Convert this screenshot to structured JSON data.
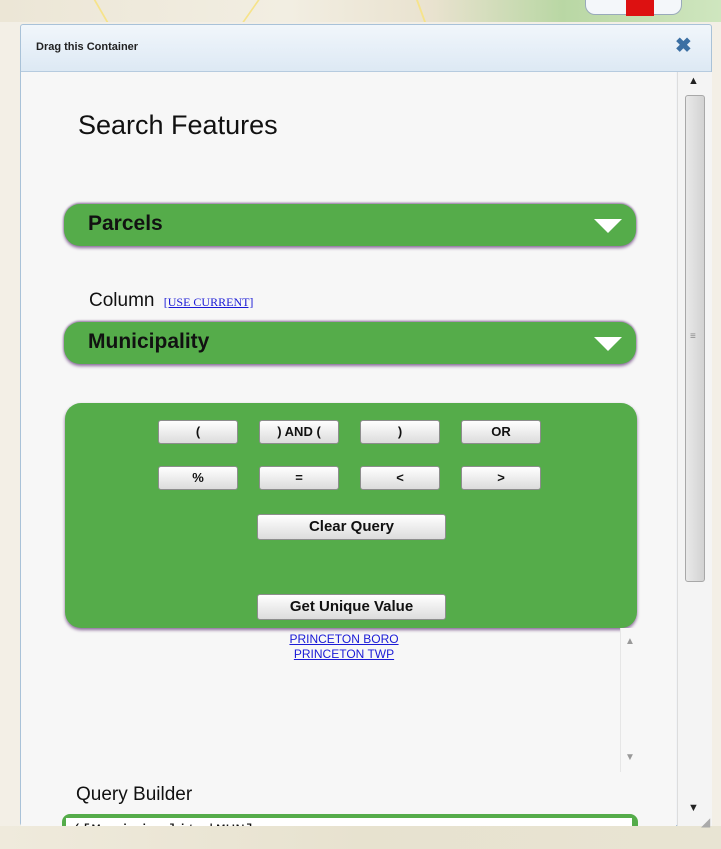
{
  "window": {
    "title": "Drag this Container",
    "close_icon": "close-x-icon"
  },
  "search": {
    "heading": "Search Features",
    "layer_dropdown": {
      "selected": "Parcels"
    },
    "column_label": "Column",
    "use_current_link": "[USE CURRENT]",
    "column_dropdown": {
      "selected": "Municipality"
    }
  },
  "operators": {
    "row1": [
      "(",
      ") AND (",
      ")",
      "OR"
    ],
    "row2": [
      "%",
      "=",
      "<",
      ">"
    ],
    "clear_query": "Clear Query",
    "get_unique_value": "Get Unique Value"
  },
  "unique_values": [
    "PRINCETON BORO",
    "PRINCETON TWP"
  ],
  "query_builder": {
    "label": "Query Builder",
    "value": "([Municipality|MUN]"
  },
  "colors": {
    "panel_green": "#55ac4a",
    "link_blue": "#1a1ad6",
    "titlebar": "#dde9f4"
  }
}
